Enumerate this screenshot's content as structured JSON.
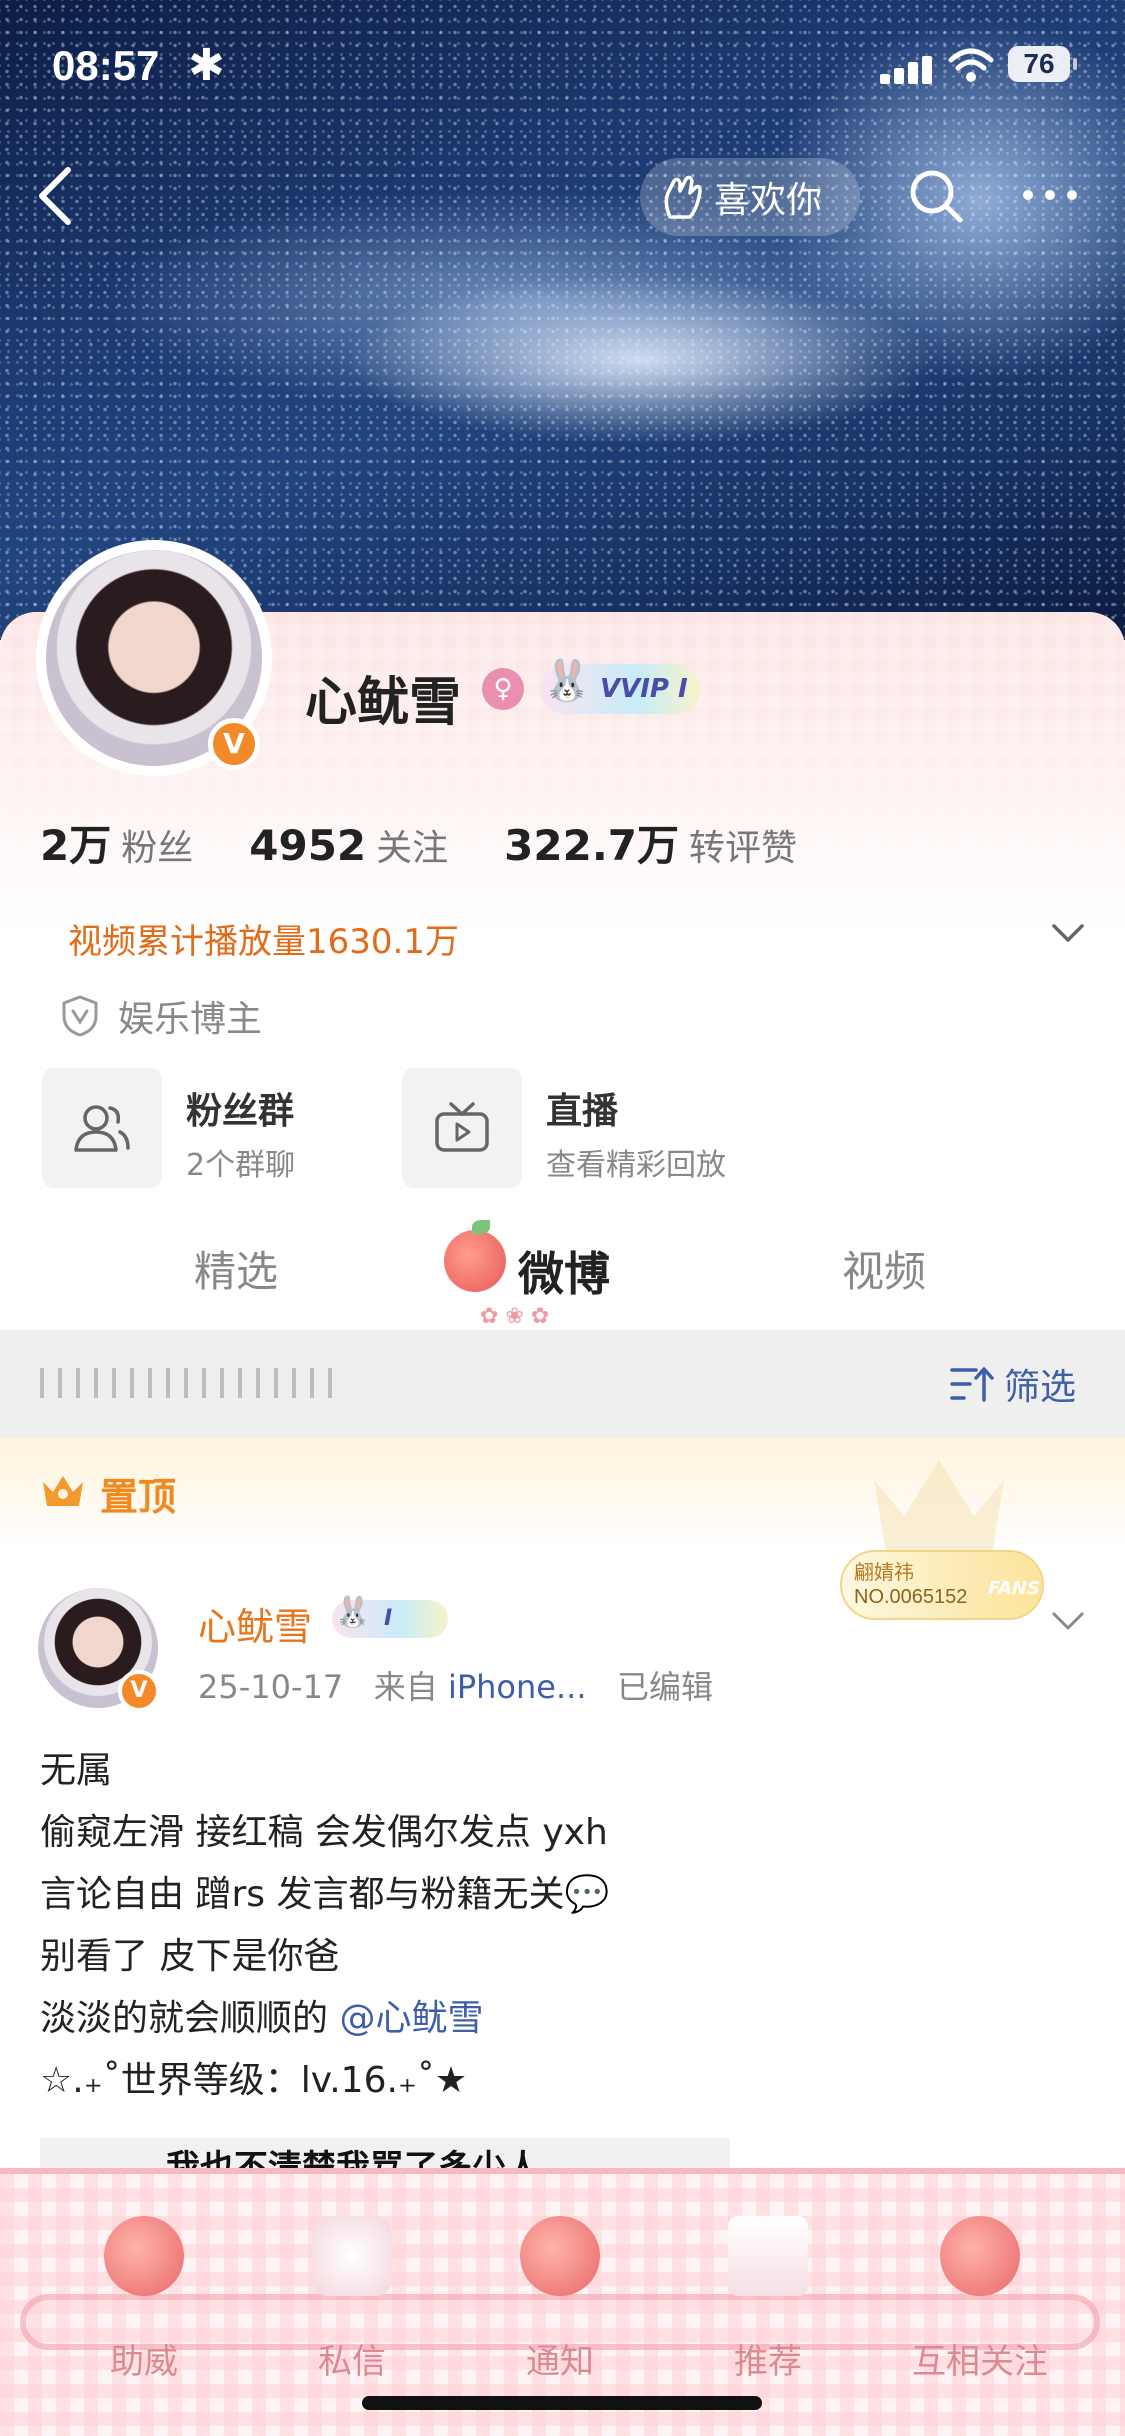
{
  "status_bar": {
    "time": "08:57",
    "extra_icon": "✱",
    "battery": "76"
  },
  "header": {
    "like_label": "喜欢你"
  },
  "profile": {
    "name": "心鱿雪",
    "vvip_label": "VVIP",
    "vvip_level": "I",
    "verified_badge": "V",
    "stats": [
      {
        "value": "2万",
        "label": "粉丝"
      },
      {
        "value": "4952",
        "label": "关注"
      },
      {
        "value": "322.7万",
        "label": "转评赞"
      }
    ],
    "video_plays": "视频累计播放量1630.1万",
    "certification": "娱乐博主",
    "actions": [
      {
        "title": "粉丝群",
        "subtitle": "2个群聊"
      },
      {
        "title": "直播",
        "subtitle": "查看精彩回放"
      }
    ]
  },
  "tabs": [
    {
      "label": "精选"
    },
    {
      "label": "微博"
    },
    {
      "label": "视频"
    }
  ],
  "filter": {
    "label": "筛选"
  },
  "pinned": {
    "label": "置顶",
    "fans_badge": {
      "name": "翩婧祎",
      "number": "NO.0065152",
      "word": "FANS"
    },
    "author": "心鱿雪",
    "author_vip_level": "I",
    "date": "25-10-17",
    "source_prefix": "来自",
    "source": "iPhone...",
    "edited": "已编辑",
    "lines": [
      "无属",
      "偷窥左滑 接红稿 会发偶尔发点 yxh",
      "言论自由 蹭rs 发言都与粉籍无关💬",
      "别看了 皮下是你爸",
      "淡淡的就会顺顺的 ",
      "☆.₊˚世界等级：lv.16.₊˚★"
    ],
    "mention": "@心鱿雪",
    "image_caption": "我也不清楚我骂了多少人"
  },
  "bottom_nav": [
    {
      "label": "助威"
    },
    {
      "label": "私信"
    },
    {
      "label": "通知"
    },
    {
      "label": "推荐"
    },
    {
      "label": "互相关注"
    }
  ],
  "colors": {
    "accent_orange": "#e8751a",
    "link_blue": "#3e5fa8",
    "pink": "#f7b9c0"
  }
}
